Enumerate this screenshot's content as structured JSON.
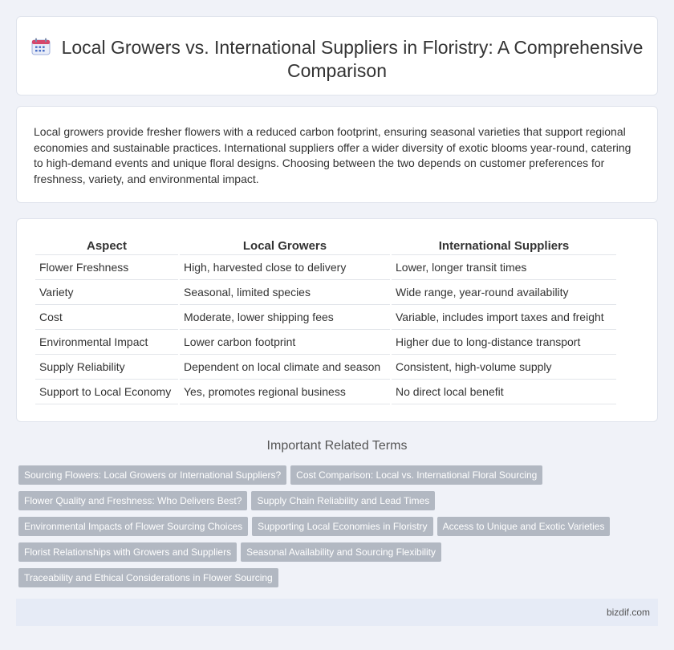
{
  "header": {
    "title": "Local Growers vs. International Suppliers in Floristry: A Comprehensive Comparison",
    "icon": "calendar-icon"
  },
  "intro": {
    "text": "Local growers provide fresher flowers with a reduced carbon footprint, ensuring seasonal varieties that support regional economies and sustainable practices. International suppliers offer a wider diversity of exotic blooms year-round, catering to high-demand events and unique floral designs. Choosing between the two depends on customer preferences for freshness, variety, and environmental impact."
  },
  "table": {
    "headers": [
      "Aspect",
      "Local Growers",
      "International Suppliers"
    ],
    "rows": [
      [
        "Flower Freshness",
        "High, harvested close to delivery",
        "Lower, longer transit times"
      ],
      [
        "Variety",
        "Seasonal, limited species",
        "Wide range, year-round availability"
      ],
      [
        "Cost",
        "Moderate, lower shipping fees",
        "Variable, includes import taxes and freight"
      ],
      [
        "Environmental Impact",
        "Lower carbon footprint",
        "Higher due to long-distance transport"
      ],
      [
        "Supply Reliability",
        "Dependent on local climate and season",
        "Consistent, high-volume supply"
      ],
      [
        "Support to Local Economy",
        "Yes, promotes regional business",
        "No direct local benefit"
      ]
    ]
  },
  "related": {
    "heading": "Important Related Terms",
    "tag_rows": [
      [
        "Sourcing Flowers: Local Growers or International Suppliers?",
        "Cost Comparison: Local vs. International Floral Sourcing"
      ],
      [
        "Flower Quality and Freshness: Who Delivers Best?",
        "Supply Chain Reliability and Lead Times"
      ],
      [
        "Environmental Impacts of Flower Sourcing Choices",
        "Supporting Local Economies in Floristry",
        "Access to Unique and Exotic Varieties"
      ],
      [
        "Florist Relationships with Growers and Suppliers",
        "Seasonal Availability and Sourcing Flexibility"
      ],
      [
        "Traceability and Ethical Considerations in Flower Sourcing"
      ]
    ]
  },
  "footer": {
    "site": "bizdif.com"
  },
  "colors": {
    "page_bg": "#f0f2f8",
    "tag_bg": "#b2b8c2",
    "footer_bg": "#e6ebf6",
    "icon_accent": "#4a6fc7"
  }
}
